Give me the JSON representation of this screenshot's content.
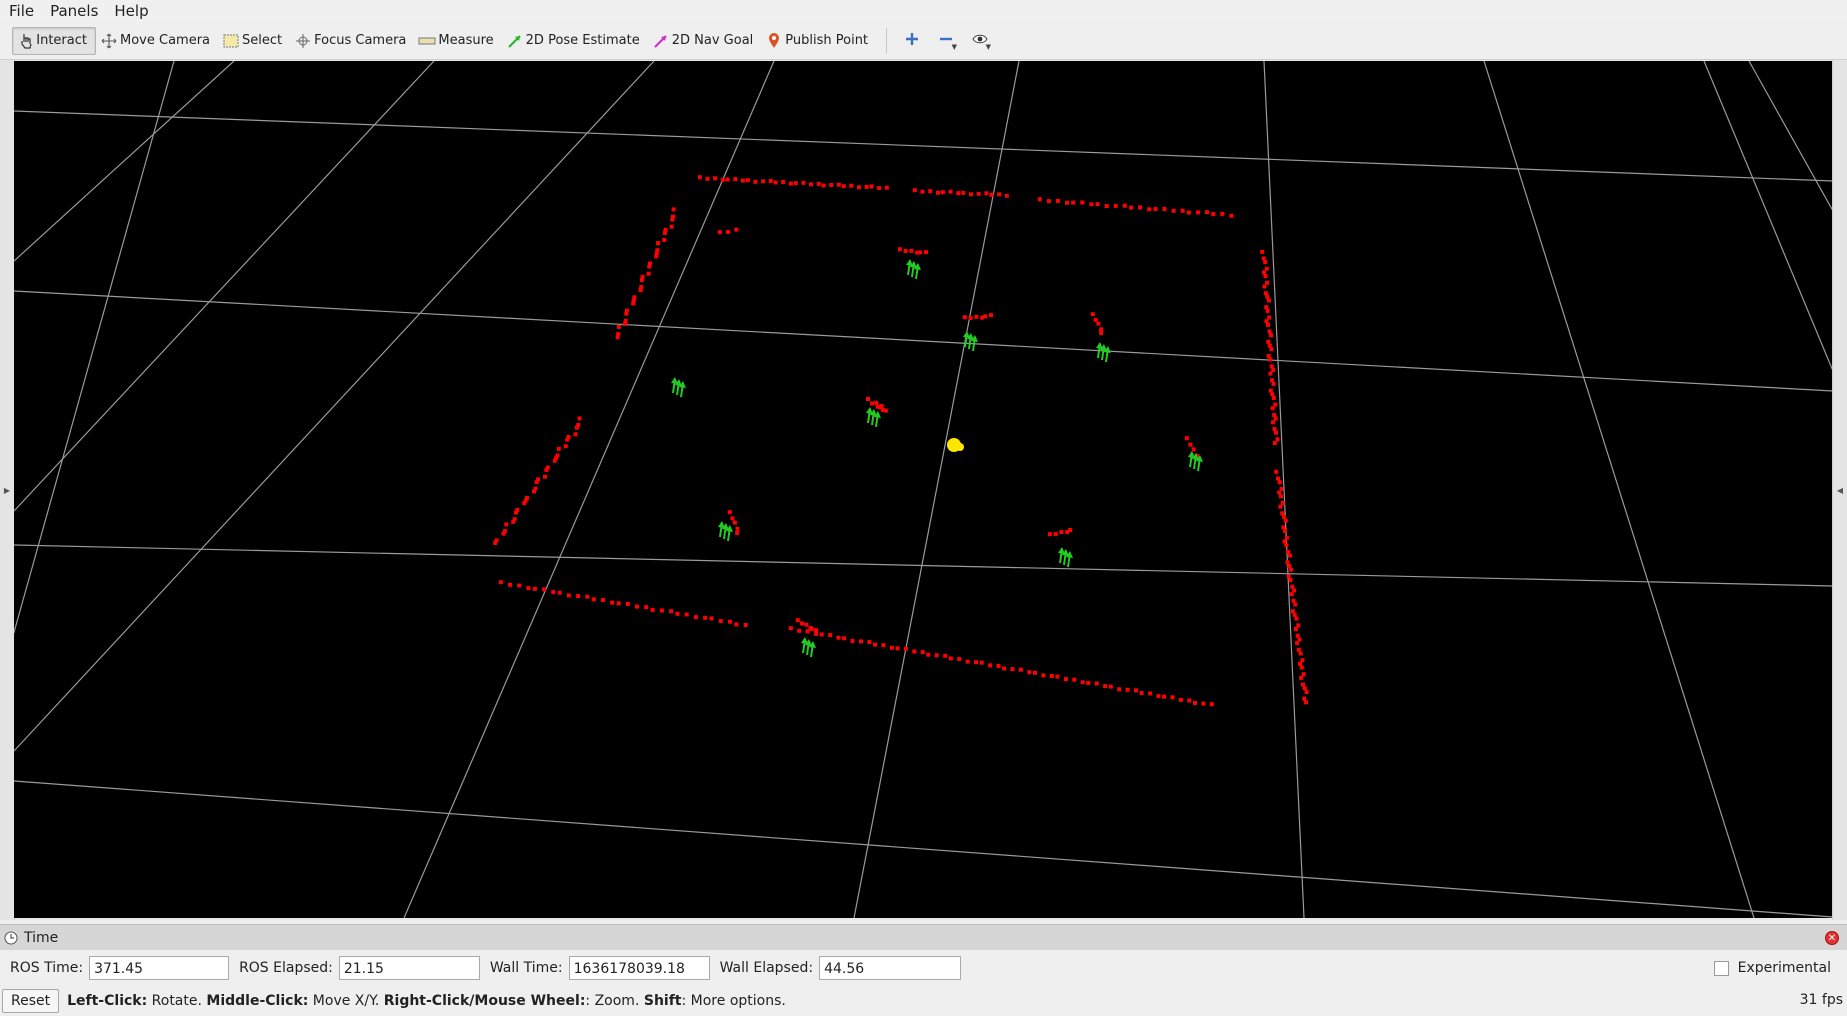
{
  "menu": {
    "file": "File",
    "panels": "Panels",
    "help": "Help"
  },
  "toolbar": {
    "interact": "Interact",
    "move_camera": "Move Camera",
    "select": "Select",
    "focus_camera": "Focus Camera",
    "measure": "Measure",
    "pose_estimate": "2D Pose Estimate",
    "nav_goal": "2D Nav Goal",
    "publish_point": "Publish Point"
  },
  "time_panel": {
    "title": "Time",
    "ros_time_label": "ROS Time:",
    "ros_time": "371.45",
    "ros_elapsed_label": "ROS Elapsed:",
    "ros_elapsed": "21.15",
    "wall_time_label": "Wall Time:",
    "wall_time": "1636178039.18",
    "wall_elapsed_label": "Wall Elapsed:",
    "wall_elapsed": "44.56",
    "experimental": "Experimental"
  },
  "status": {
    "reset": "Reset",
    "hint_left": "Left-Click:",
    "hint_left_action": " Rotate. ",
    "hint_middle": "Middle-Click:",
    "hint_middle_action": " Move X/Y. ",
    "hint_right": "Right-Click/Mouse Wheel:",
    "hint_right_action": ": Zoom. ",
    "hint_shift": "Shift",
    "hint_shift_action": ": More options.",
    "fps": "31 fps"
  },
  "colors": {
    "scan_points": "#ff0000",
    "robot_arrows": "#22cc22",
    "robot_marker": "#ffe600",
    "grid": "#a0a0a0",
    "background": "#000000"
  }
}
